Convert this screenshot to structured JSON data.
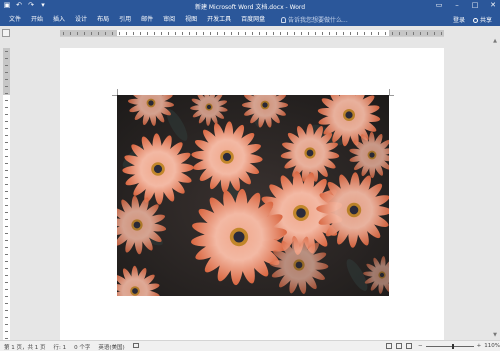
{
  "window": {
    "title": "新建 Microsoft Word 文档.docx - Word",
    "qat_icons": [
      "save-icon",
      "undo-icon",
      "redo-icon",
      "customize-icon"
    ],
    "controls": [
      "minimize-icon",
      "maximize-icon",
      "close-icon"
    ]
  },
  "ribbon": {
    "tabs": [
      "文件",
      "开始",
      "插入",
      "设计",
      "布局",
      "引用",
      "邮件",
      "审阅",
      "视图",
      "开发工具",
      "百度网盘"
    ],
    "tell_me": "告诉我您想要做什么...",
    "sign_in": "登录",
    "share": "共享"
  },
  "document": {
    "image_description": "picture of orange daisies (osteospermum) on dark background"
  },
  "status": {
    "page": "第 1 页，共 1 页",
    "line": "行: 1",
    "words": "0 个字",
    "language": "英语(美国)",
    "zoom_level": "110%",
    "zoom_value": 0.58
  },
  "colors": {
    "accent": "#2b579a",
    "status_bar": "#f0f0f0",
    "workspace": "#e6e6e6"
  }
}
